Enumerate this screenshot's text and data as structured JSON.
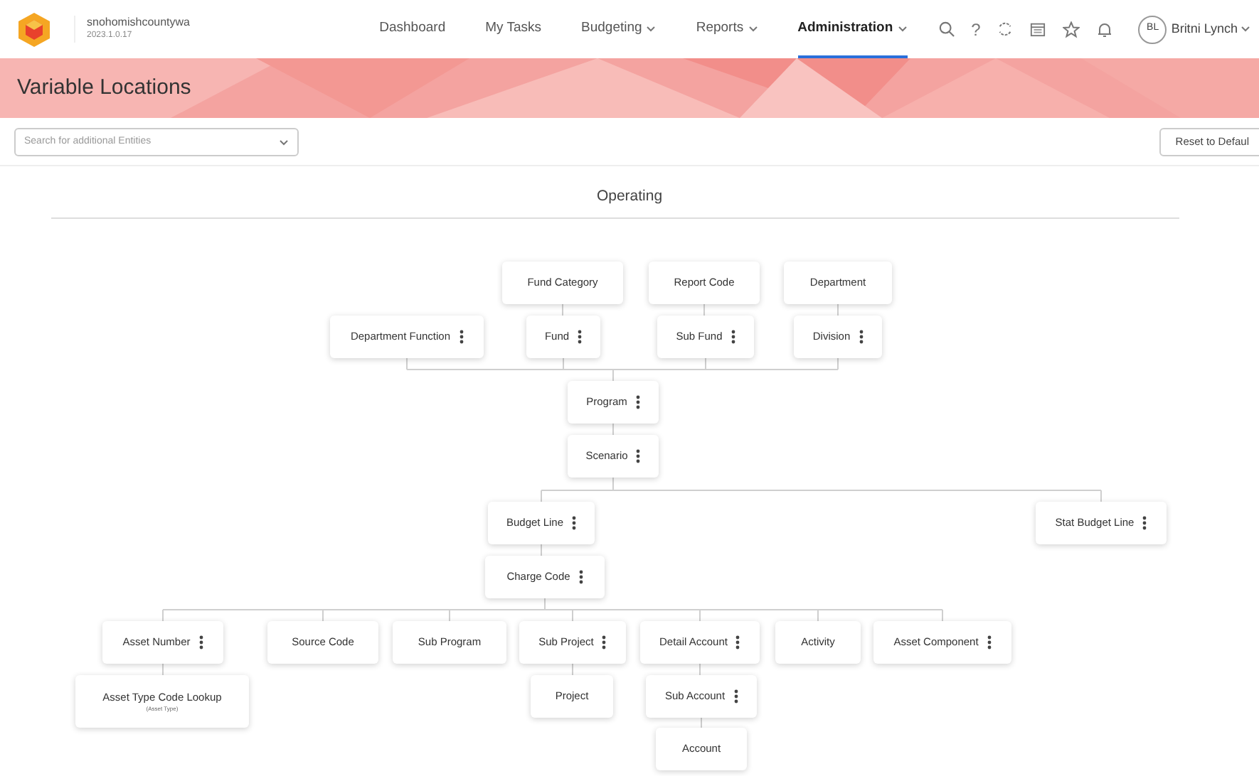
{
  "app": {
    "org": "snohomishcountywa",
    "version": "2023.1.0.17"
  },
  "nav": [
    {
      "label": "Dashboard",
      "selected": false,
      "dropdown": false
    },
    {
      "label": "My Tasks",
      "selected": false,
      "dropdown": false
    },
    {
      "label": "Budgeting",
      "selected": false,
      "dropdown": true
    },
    {
      "label": "Reports",
      "selected": false,
      "dropdown": true
    },
    {
      "label": "Administration",
      "selected": true,
      "dropdown": true
    }
  ],
  "help_glyph": "?",
  "user": {
    "initials": "BL",
    "name": "Britni Lynch"
  },
  "page_title": "Variable Locations",
  "entity_search": {
    "placeholder": "Search for additional Entities"
  },
  "reset_button": "Reset to Defaul",
  "section_title": "Operating",
  "nodes": [
    {
      "label": "Fund Category",
      "menu": false
    },
    {
      "label": "Report Code",
      "menu": false
    },
    {
      "label": "Department",
      "menu": false
    },
    {
      "label": "Department Function",
      "menu": true
    },
    {
      "label": "Fund",
      "menu": true
    },
    {
      "label": "Sub Fund",
      "menu": true
    },
    {
      "label": "Division",
      "menu": true
    },
    {
      "label": "Program",
      "menu": true
    },
    {
      "label": "Scenario",
      "menu": true
    },
    {
      "label": "Budget Line",
      "menu": true
    },
    {
      "label": "Stat Budget Line",
      "menu": true
    },
    {
      "label": "Charge Code",
      "menu": true
    },
    {
      "label": "Asset Number",
      "menu": true
    },
    {
      "label": "Source Code",
      "menu": false
    },
    {
      "label": "Sub Program",
      "menu": false
    },
    {
      "label": "Sub Project",
      "menu": true
    },
    {
      "label": "Detail Account",
      "menu": true
    },
    {
      "label": "Activity",
      "menu": false
    },
    {
      "label": "Asset Component",
      "menu": true
    },
    {
      "label": "Asset Type Code Lookup",
      "sublabel": "(Asset Type)",
      "menu": false
    },
    {
      "label": "Project",
      "menu": false
    },
    {
      "label": "Sub Account",
      "menu": true
    },
    {
      "label": "Account",
      "menu": false
    }
  ]
}
